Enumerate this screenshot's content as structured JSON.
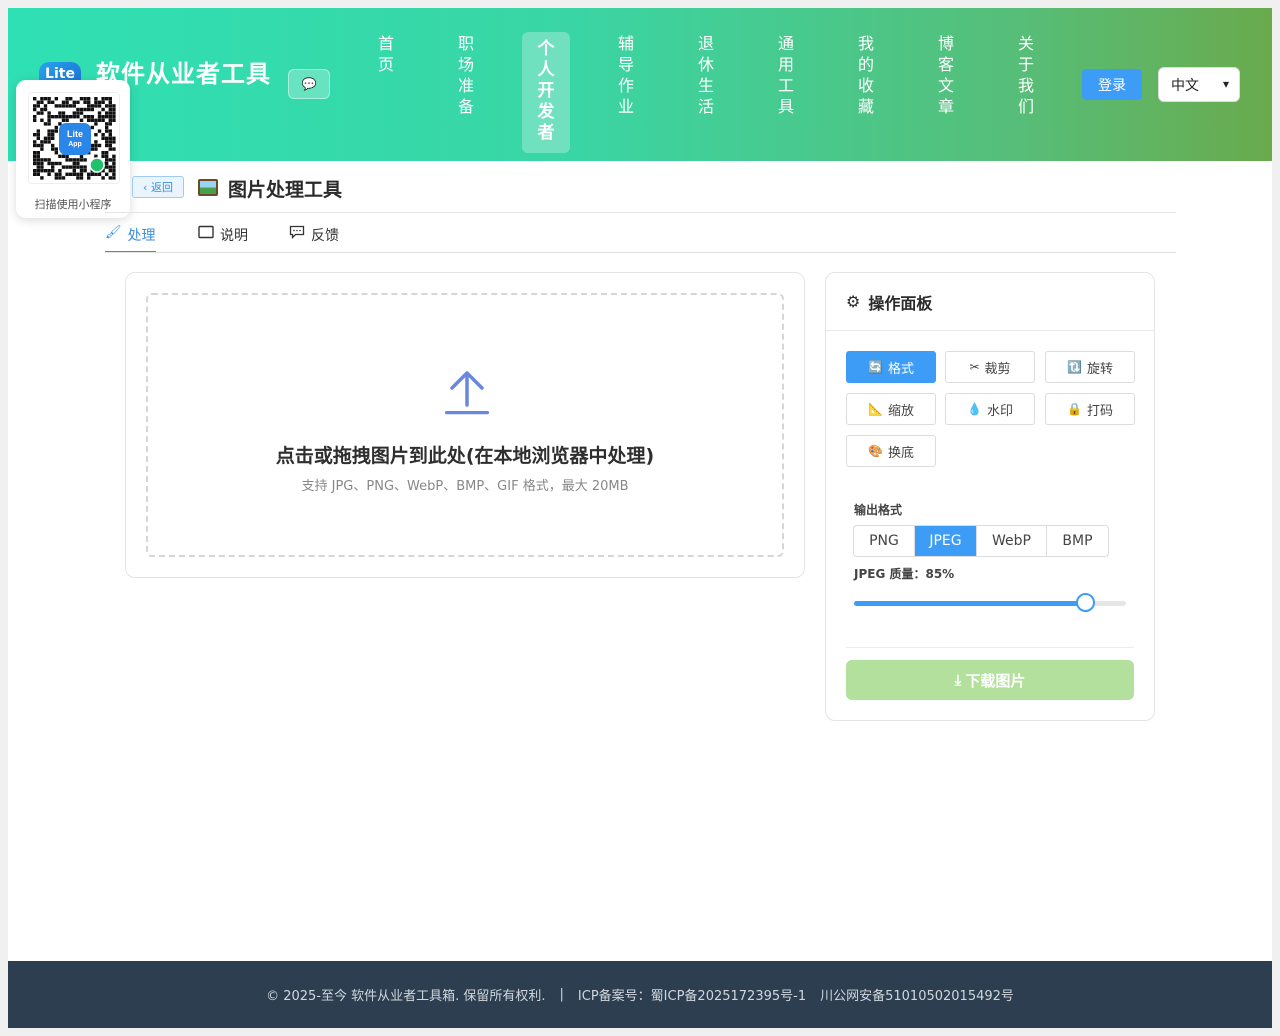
{
  "header": {
    "logo_text": "Lite",
    "site_title": "软件从业者工具",
    "chat_icon": "💬",
    "nav": [
      {
        "label": "首页",
        "active": false
      },
      {
        "label": "职场准备",
        "active": false
      },
      {
        "label": "个人开发者",
        "active": true
      },
      {
        "label": "辅导作业",
        "active": false
      },
      {
        "label": "退休生活",
        "active": false
      },
      {
        "label": "通用工具",
        "active": false
      },
      {
        "label": "我的收藏",
        "active": false
      },
      {
        "label": "博客文章",
        "active": false
      },
      {
        "label": "关于我们",
        "active": false
      }
    ],
    "login_label": "登录",
    "language": "中文"
  },
  "qr_popup": {
    "badge_line1": "Lite",
    "badge_line2": "App",
    "caption": "扫描使用小程序"
  },
  "page": {
    "back_label": "返回",
    "title": "图片处理工具",
    "tabs": [
      {
        "label": "处理",
        "icon": "brush-icon",
        "active": true
      },
      {
        "label": "说明",
        "icon": "book-icon",
        "active": false
      },
      {
        "label": "反馈",
        "icon": "comment-icon",
        "active": false
      }
    ]
  },
  "upload": {
    "title": "点击或拖拽图片到此处(在本地浏览器中处理)",
    "subtitle": "支持 JPG、PNG、WebP、BMP、GIF 格式，最大 20MB"
  },
  "panel": {
    "title": "操作面板",
    "tools": [
      {
        "label": "格式",
        "glyph": "🔄",
        "active": true
      },
      {
        "label": "裁剪",
        "glyph": "✂",
        "active": false
      },
      {
        "label": "旋转",
        "glyph": "🔃",
        "active": false
      },
      {
        "label": "缩放",
        "glyph": "📐",
        "active": false
      },
      {
        "label": "水印",
        "glyph": "💧",
        "active": false
      },
      {
        "label": "打码",
        "glyph": "🔒",
        "active": false
      },
      {
        "label": "换底",
        "glyph": "🎨",
        "active": false
      }
    ],
    "output_format_label": "输出格式",
    "formats": [
      {
        "label": "PNG",
        "active": false
      },
      {
        "label": "JPEG",
        "active": true
      },
      {
        "label": "WebP",
        "active": false
      },
      {
        "label": "BMP",
        "active": false
      }
    ],
    "quality_label": "JPEG 质量：85%",
    "quality_value": 85,
    "download_label": "下载图片"
  },
  "footer": {
    "copyright": "© 2025-至今 软件从业者工具箱. 保留所有权利.",
    "separator": "|",
    "icp": "ICP备案号：蜀ICP备2025172395号-1",
    "police": "川公网安备51010502015492号"
  },
  "colors": {
    "accent": "#3d9cf5",
    "download_disabled": "#b3e19d",
    "footer_bg": "#2c3e50"
  }
}
